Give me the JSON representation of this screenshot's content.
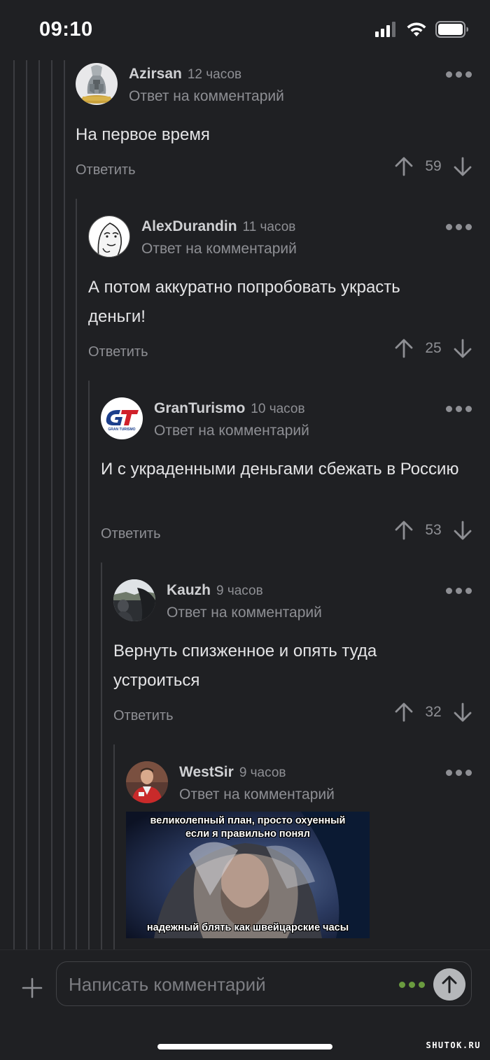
{
  "status": {
    "time": "09:10"
  },
  "comments": [
    {
      "author": "Azirsan",
      "time": "12 часов",
      "reply_to": "Ответ на комментарий",
      "body": "На первое время",
      "reply": "Ответить",
      "votes": "59"
    },
    {
      "author": "AlexDurandin",
      "time": "11 часов",
      "reply_to": "Ответ на комментарий",
      "body": "А потом аккуратно попробовать украсть деньги!",
      "reply": "Ответить",
      "votes": "25"
    },
    {
      "author": "GranTurismo",
      "time": "10 часов",
      "reply_to": "Ответ на комментарий",
      "body": "И с украденными деньгами сбежать в Россию",
      "reply": "Ответить",
      "votes": "53"
    },
    {
      "author": "Kauzh",
      "time": "9 часов",
      "reply_to": "Ответ на комментарий",
      "body": "Вернуть спизженное и опять туда устроиться",
      "reply": "Ответить",
      "votes": "32"
    },
    {
      "author": "WestSir",
      "time": "9 часов",
      "reply_to": "Ответ на комментарий"
    }
  ],
  "meme": {
    "caption_top_1": "великолепный план, просто охуенный",
    "caption_top_2": "если я правильно понял",
    "caption_bottom": "надежный блять как швейцарские часы"
  },
  "avatar_labels": {
    "granturismo": "GRAN TURISMO"
  },
  "composer": {
    "placeholder": "Написать комментарий"
  },
  "watermark": "SHUTOK.RU",
  "icons": [
    "signal-icon",
    "wifi-icon",
    "battery-icon",
    "more-icon",
    "upvote-icon",
    "downvote-icon",
    "plus-icon",
    "send-icon"
  ],
  "colors": {
    "background": "#1f2023",
    "text": "#e4e4e6",
    "muted": "#8e8f94",
    "thread_line": "#3b3c40",
    "accent_green": "#6a9b3f"
  }
}
